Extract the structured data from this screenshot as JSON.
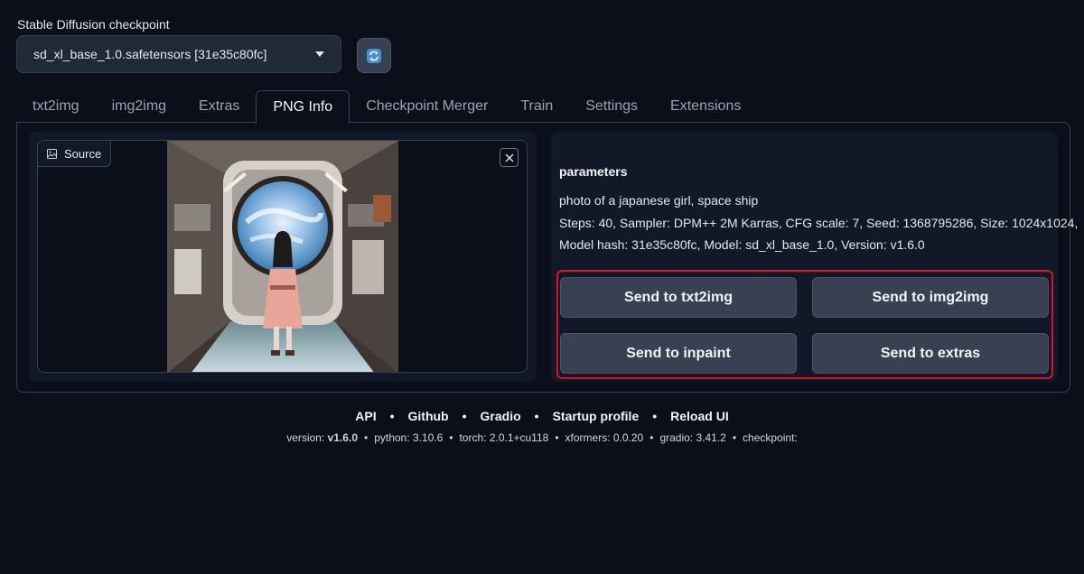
{
  "checkpoint": {
    "label": "Stable Diffusion checkpoint",
    "value": "sd_xl_base_1.0.safetensors [31e35c80fc]"
  },
  "tabs": [
    {
      "label": "txt2img"
    },
    {
      "label": "img2img"
    },
    {
      "label": "Extras"
    },
    {
      "label": "PNG Info",
      "active": true
    },
    {
      "label": "Checkpoint Merger"
    },
    {
      "label": "Train"
    },
    {
      "label": "Settings"
    },
    {
      "label": "Extensions"
    }
  ],
  "source": {
    "label": "Source"
  },
  "params": {
    "title": "parameters",
    "prompt": "photo of a japanese girl, space ship",
    "line2": "Steps: 40, Sampler: DPM++ 2M Karras, CFG scale: 7, Seed: 1368795286, Size: 1024x1024,",
    "line3": "Model hash: 31e35c80fc, Model: sd_xl_base_1.0, Version: v1.6.0"
  },
  "buttons": {
    "txt2img": "Send to txt2img",
    "img2img": "Send to img2img",
    "inpaint": "Send to inpaint",
    "extras": "Send to extras"
  },
  "footer": {
    "links": [
      "API",
      "Github",
      "Gradio",
      "Startup profile",
      "Reload UI"
    ],
    "version_label": "version:",
    "version_value": "v1.6.0",
    "python": "python: 3.10.6",
    "torch": "torch: 2.0.1+cu118",
    "xformers": "xformers: 0.0.20",
    "gradio": "gradio: 3.41.2",
    "checkpoint": "checkpoint:"
  },
  "colors": {
    "background": "#0b0f19",
    "panel": "#111827",
    "button": "#374151",
    "highlight": "#e0102a"
  }
}
